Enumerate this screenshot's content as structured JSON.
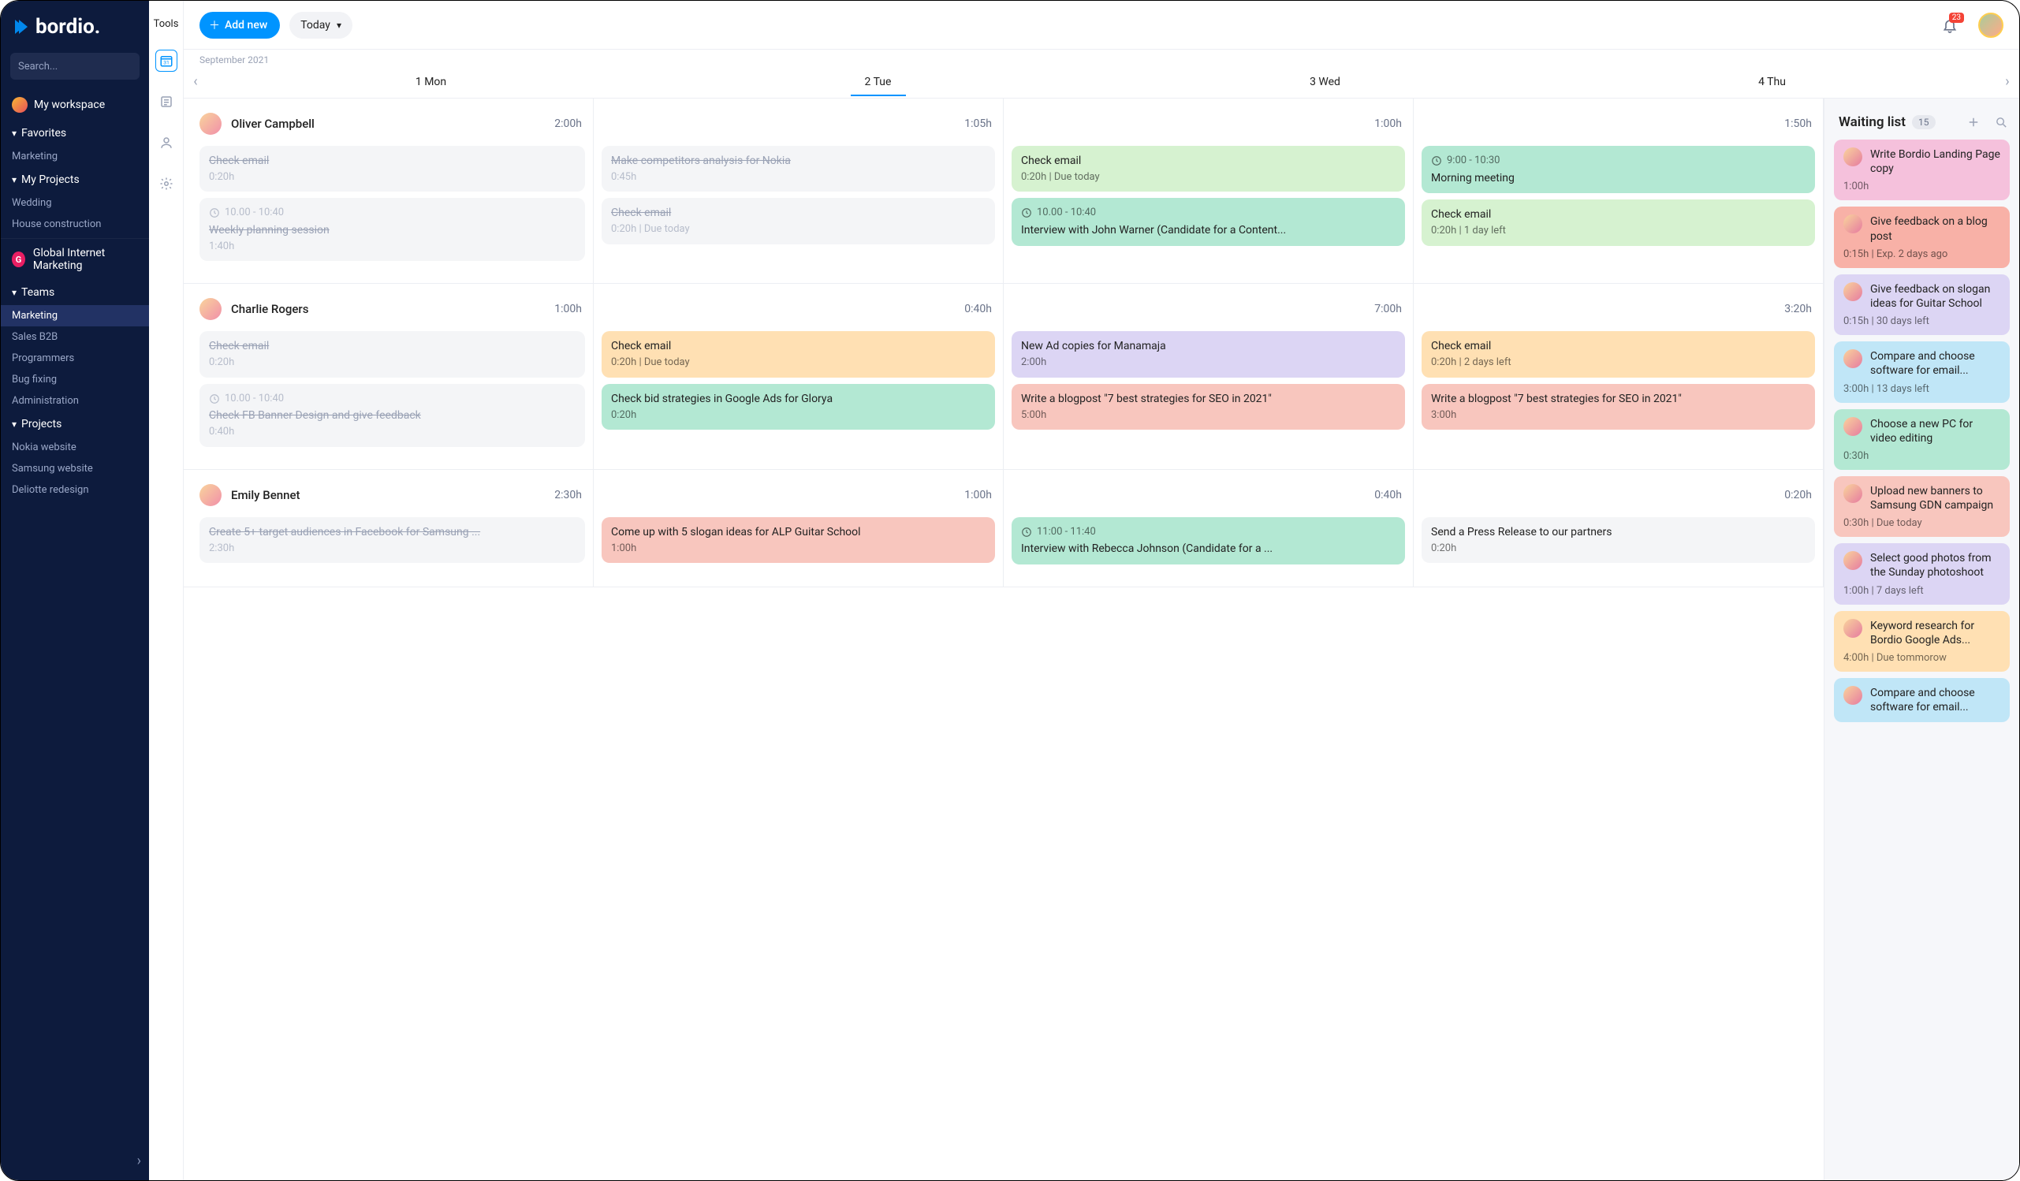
{
  "brand": "bordio.",
  "search_placeholder": "Search...",
  "workspace_label": "My workspace",
  "sidebar": {
    "favorites_label": "Favorites",
    "favorites": [
      "Marketing"
    ],
    "myprojects_label": "My Projects",
    "myprojects": [
      "Wedding",
      "House construction"
    ],
    "org_name": "Global Internet Marketing",
    "org_initial": "G",
    "teams_label": "Teams",
    "teams": [
      "Marketing",
      "Sales B2B",
      "Programmers",
      "Bug fixing",
      "Administration"
    ],
    "projects_label": "Projects",
    "projects": [
      "Nokia website",
      "Samsung website",
      "Deliotte redesign"
    ]
  },
  "toolrail_label": "Tools",
  "topbar": {
    "add_label": "Add new",
    "today_label": "Today",
    "notif_count": "23"
  },
  "calendar": {
    "month_label": "September 2021",
    "days": [
      {
        "label": "1 Mon"
      },
      {
        "label": "2 Tue",
        "active": true
      },
      {
        "label": "3 Wed"
      },
      {
        "label": "4 Thu"
      }
    ]
  },
  "people": [
    {
      "name": "Oliver Campbell",
      "hours": [
        "2:00h",
        "1:05h",
        "1:00h",
        "1:50h"
      ],
      "columns": [
        [
          {
            "title": "Check email",
            "meta": "0:20h",
            "color": "c-gray",
            "completed": true
          },
          {
            "time": "10.00 - 10:40",
            "title": "Weekly planning session",
            "meta": "1:40h",
            "color": "c-gray",
            "completed": true
          }
        ],
        [
          {
            "title": "Make competitors analysis for Nokia",
            "meta": "0:45h",
            "color": "c-gray",
            "completed": true
          },
          {
            "title": "Check email",
            "meta": "0:20h | Due today",
            "color": "c-gray",
            "completed": true
          }
        ],
        [
          {
            "title": "Check email",
            "meta": "0:20h | Due today",
            "color": "c-green-light"
          },
          {
            "time": "10.00 - 10:40",
            "title": "Interview with John Warner (Candidate for a Content...",
            "color": "c-green"
          }
        ],
        [
          {
            "time": "9:00 - 10:30",
            "title": "Morning meeting",
            "color": "c-green"
          },
          {
            "title": "Check email",
            "meta": "0:20h | 1 day left",
            "color": "c-green-light"
          }
        ]
      ]
    },
    {
      "name": "Charlie Rogers",
      "hours": [
        "1:00h",
        "0:40h",
        "7:00h",
        "3:20h"
      ],
      "columns": [
        [
          {
            "title": "Check email",
            "meta": "0:20h",
            "color": "c-gray",
            "completed": true
          },
          {
            "time": "10.00 - 10:40",
            "title": "Check FB Banner Design and give feedback",
            "meta": "0:40h",
            "color": "c-gray",
            "completed": true
          }
        ],
        [
          {
            "title": "Check email",
            "meta": "0:20h | Due today",
            "color": "c-orange"
          },
          {
            "title": "Check bid strategies in Google Ads for Glorya",
            "meta": "0:20h",
            "color": "c-green"
          }
        ],
        [
          {
            "title": "New Ad copies for Manamaja",
            "meta": "2:00h",
            "color": "c-lavender"
          },
          {
            "title": "Write a blogpost \"7 best strategies for SEO in 2021\"",
            "meta": "5:00h",
            "color": "c-salmon"
          }
        ],
        [
          {
            "title": "Check email",
            "meta": "0:20h | 2 days left",
            "color": "c-orange"
          },
          {
            "title": "Write a blogpost \"7 best strategies for SEO in 2021\"",
            "meta": "3:00h",
            "color": "c-salmon"
          }
        ]
      ]
    },
    {
      "name": "Emily Bennet",
      "hours": [
        "2:30h",
        "1:00h",
        "0:40h",
        "0:20h"
      ],
      "columns": [
        [
          {
            "title": "Create 5+ target audiences in Facebook for Samsung ...",
            "meta": "2:30h",
            "color": "c-gray",
            "completed": true
          }
        ],
        [
          {
            "title": "Come up with 5 slogan ideas for ALP Guitar School",
            "meta": "1:00h",
            "color": "c-salmon"
          }
        ],
        [
          {
            "time": "11:00 - 11:40",
            "title": "Interview with Rebecca Johnson (Candidate for a ...",
            "color": "c-green"
          }
        ],
        [
          {
            "title": "Send a Press Release to our partners",
            "meta": "0:20h",
            "color": "c-gray"
          }
        ]
      ]
    }
  ],
  "waiting": {
    "title": "Waiting list",
    "count": "15",
    "items": [
      {
        "title": "Write Bordio Landing Page copy",
        "meta": "1:00h",
        "color": "c-pink"
      },
      {
        "title": "Give feedback on a blog post",
        "meta": "0:15h | Exp. 2 days ago",
        "color": "c-red"
      },
      {
        "title": "Give feedback on slogan ideas for Guitar School",
        "meta": "0:15h | 30 days left",
        "color": "c-lavender"
      },
      {
        "title": "Compare and choose software for email...",
        "meta": "3:00h | 13 days left",
        "color": "c-sky"
      },
      {
        "title": "Choose a new PC for video editing",
        "meta": "0:30h",
        "color": "c-green"
      },
      {
        "title": "Upload new banners to Samsung GDN campaign",
        "meta": "0:30h | Due today",
        "color": "c-salmon"
      },
      {
        "title": "Select good photos from the Sunday photoshoot",
        "meta": "1:00h | 7 days left",
        "color": "c-lavender"
      },
      {
        "title": "Keyword research for Bordio Google Ads...",
        "meta": "4:00h | Due tommorow",
        "color": "c-orange"
      },
      {
        "title": "Compare and choose software for email...",
        "meta": "",
        "color": "c-sky"
      }
    ]
  }
}
